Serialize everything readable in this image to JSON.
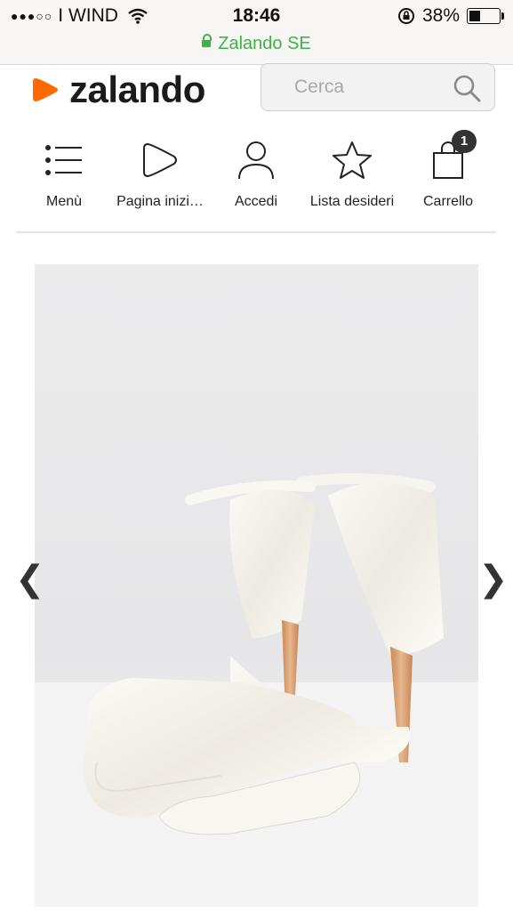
{
  "status_bar": {
    "signal": "●●●○○",
    "carrier": "I WIND",
    "time": "18:46",
    "battery": "38%",
    "battery_level": 0.38,
    "url": "Zalando SE"
  },
  "header": {
    "logo_text": "zalando",
    "search": {
      "placeholder": "Cerca"
    }
  },
  "nav": {
    "items": [
      {
        "label": "Menù",
        "icon": "menu-icon"
      },
      {
        "label": "Pagina inizi…",
        "icon": "home-icon"
      },
      {
        "label": "Accedi",
        "icon": "user-icon"
      },
      {
        "label": "Lista desideri",
        "icon": "star-icon"
      },
      {
        "label": "Carrello",
        "icon": "bag-icon",
        "badge": "1"
      }
    ]
  },
  "gallery": {
    "prev": "❮",
    "next": "❯"
  },
  "colors": {
    "brand_orange": "#ff6900",
    "secure_green": "#3fb14a"
  }
}
